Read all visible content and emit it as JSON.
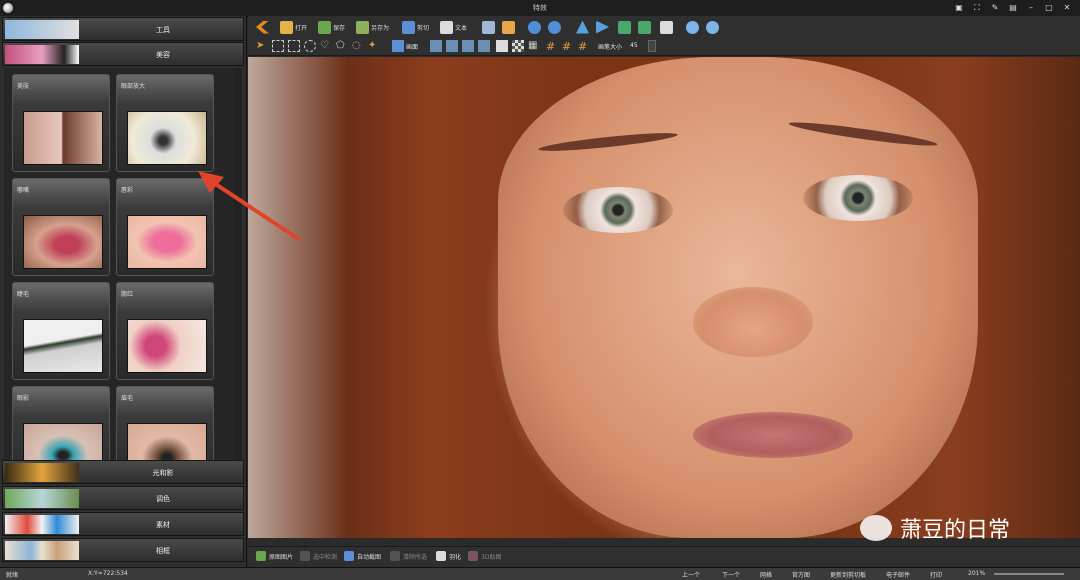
{
  "window": {
    "title": "特效"
  },
  "sidebar": {
    "categories_top": [
      {
        "label": "工具"
      },
      {
        "label": "美容"
      }
    ],
    "cards": [
      {
        "label": "美肤"
      },
      {
        "label": "眼部放大"
      },
      {
        "label": "嘟嘴"
      },
      {
        "label": "唇彩"
      },
      {
        "label": "睫毛"
      },
      {
        "label": "腮红"
      },
      {
        "label": "眼影"
      },
      {
        "label": "眉毛"
      }
    ],
    "categories_bottom": [
      {
        "label": "光和影"
      },
      {
        "label": "调色"
      },
      {
        "label": "素材"
      },
      {
        "label": "相框"
      }
    ]
  },
  "toolbar": {
    "open": "打开",
    "save": "保存",
    "save_as": "另存为",
    "crop": "剪切",
    "text": "文本",
    "shape": "形状",
    "undo": "",
    "redo": ""
  },
  "toolbar2": {
    "brush_label": "画笔大小",
    "brush_value": "45",
    "tool_label": "画面"
  },
  "bottombar": {
    "compare": "原图图片",
    "check": "选中检测",
    "auto": "自动截图",
    "clear": "清除所选",
    "edit": "羽化",
    "sticker": "3D贴图",
    "prev": "上一个",
    "next": "下一个",
    "grid": "网格",
    "official": "官方图",
    "print_setup": "更新到剪切板",
    "email": "电子邮件",
    "print": "打印",
    "zoom": "201%"
  },
  "status": {
    "left": "就绪",
    "coords": "X:Y=722:534"
  },
  "watermark": {
    "text": "萧豆的日常"
  },
  "colors": {
    "accent": "#e0442a"
  }
}
